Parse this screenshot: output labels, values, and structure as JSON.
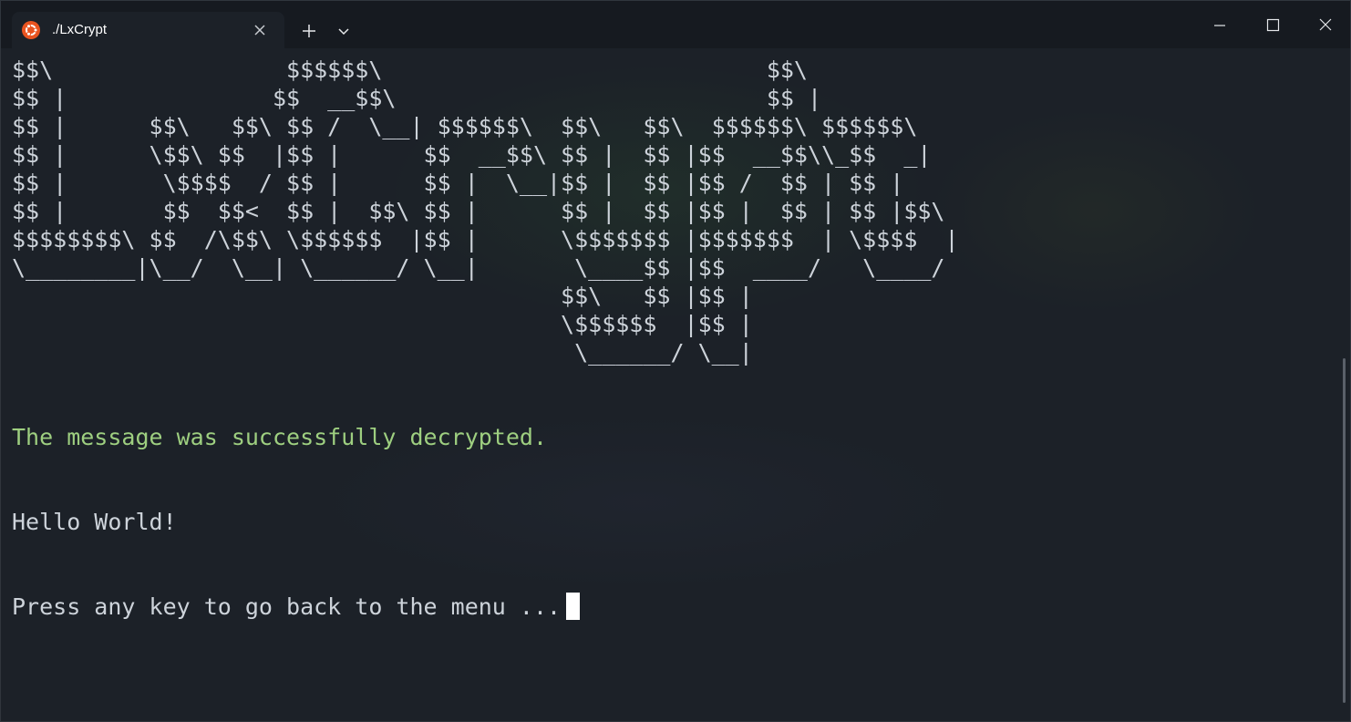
{
  "window": {
    "tab_title": "./LxCrypt",
    "tab_icon": "ubuntu-icon",
    "controls": [
      "minimize-icon",
      "maximize-icon",
      "close-icon"
    ]
  },
  "terminal": {
    "banner": "$$\\                 $$$$$$\\                            $$\\\n$$ |               $$  __$$\\                           $$ |\n$$ |      $$\\   $$\\ $$ /  \\__| $$$$$$\\  $$\\   $$\\  $$$$$$\\ $$$$$$\\\n$$ |      \\$$\\ $$  |$$ |      $$  __$$\\ $$ |  $$ |$$  __$$\\\\_$$  _|\n$$ |       \\$$$$  / $$ |      $$ |  \\__|$$ |  $$ |$$ /  $$ | $$ |\n$$ |       $$  $$<  $$ |  $$\\ $$ |      $$ |  $$ |$$ |  $$ | $$ |$$\\\n$$$$$$$$\\ $$  /\\$$\\ \\$$$$$$  |$$ |      \\$$$$$$$ |$$$$$$$  | \\$$$$  |\n\\________|\\__/  \\__| \\______/ \\__|       \\____$$ |$$  ____/   \\____/\n                                        $$\\   $$ |$$ |\n                                        \\$$$$$$  |$$ |\n                                         \\______/ \\__|",
    "success_message": "The message was successfully decrypted.",
    "decrypted_text": "Hello World!",
    "prompt": "Press any key to go back to the menu ..."
  },
  "colors": {
    "background": "#1c2128",
    "titlebar": "#161a20",
    "text": "#cdd3da",
    "success": "#9ecf80",
    "ubuntu_orange": "#e95420"
  }
}
